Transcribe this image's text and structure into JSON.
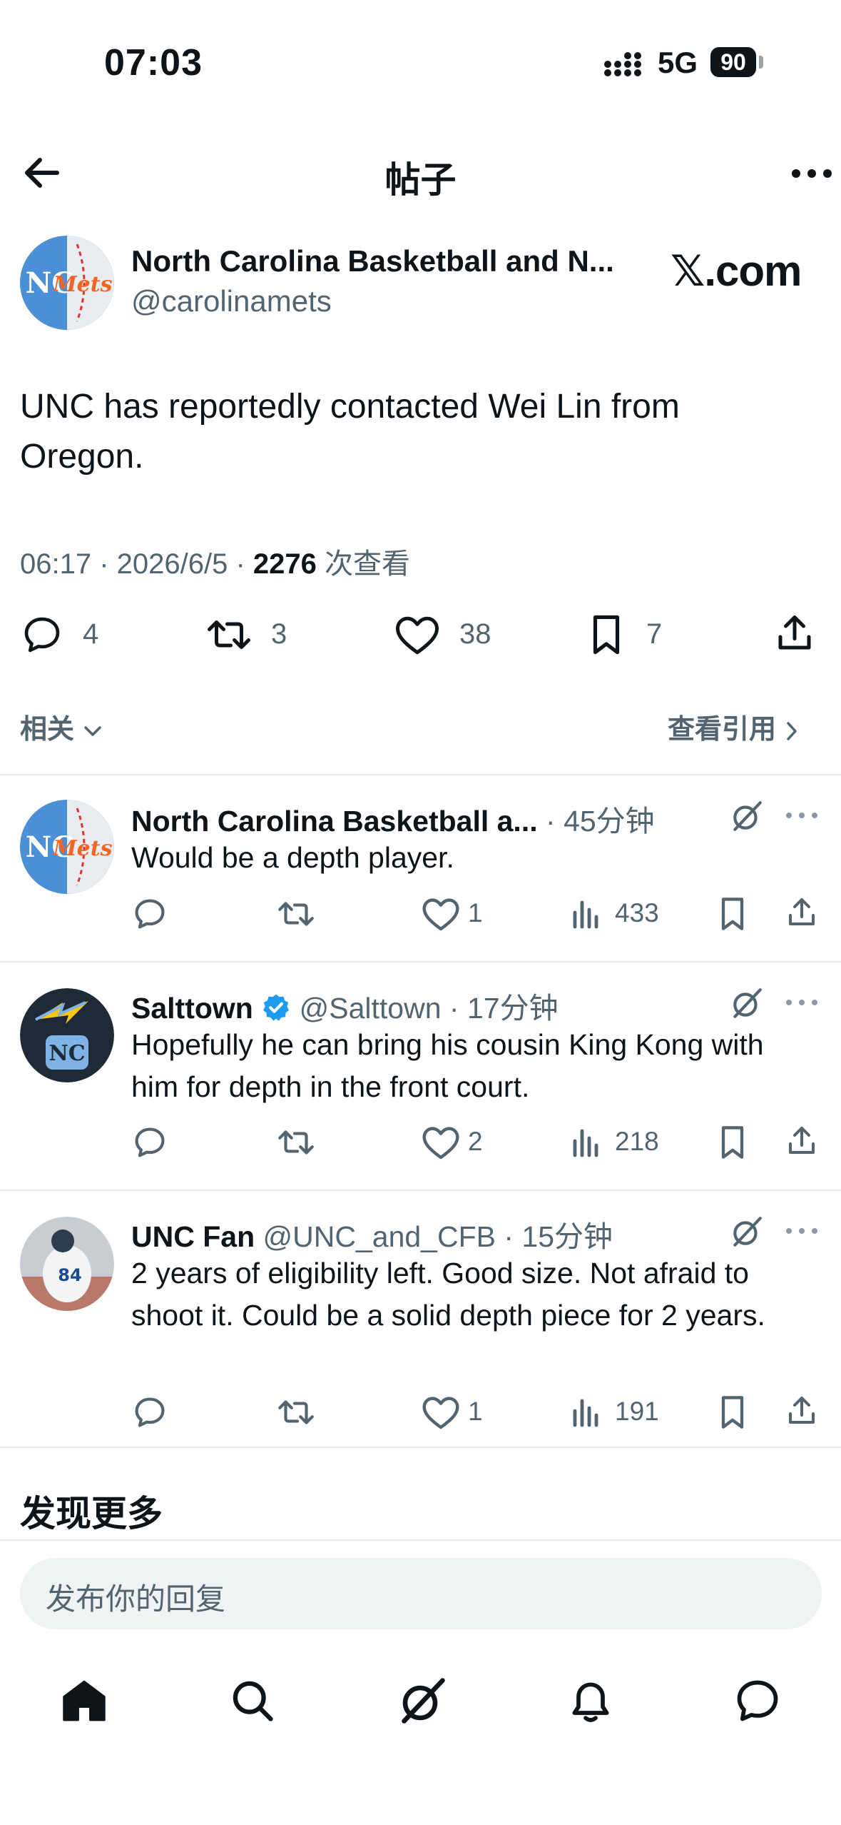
{
  "status_bar": {
    "time": "07:03",
    "network": "5G",
    "battery": "90"
  },
  "header": {
    "title": "帖子"
  },
  "post": {
    "author_name": "North Carolina Basketball and N...",
    "handle": "@carolinamets",
    "watermark": "𝕏.com",
    "text": "UNC has reportedly contacted Wei Lin from Oregon.",
    "time": "06:17",
    "date": "2026/6/5",
    "views": "2276",
    "views_label": "次查看",
    "stats": {
      "replies": "4",
      "reposts": "3",
      "likes": "38",
      "bookmarks": "7"
    },
    "related_label": "相关",
    "quotes_label": "查看引用"
  },
  "replies": [
    {
      "name": "North Carolina Basketball a...",
      "handle": "",
      "time": "45分钟",
      "text": "Would be a depth player.",
      "likes": "1",
      "views": "433"
    },
    {
      "name": "Salttown",
      "handle": "@Salttown",
      "time": "17分钟",
      "text": "Hopefully he can bring his cousin King Kong with him for depth in the front court.",
      "likes": "2",
      "views": "218"
    },
    {
      "name": "UNC Fan",
      "handle": "@UNC_and_CFB",
      "time": "15分钟",
      "text": "2 years of eligibility left. Good size. Not afraid to shoot it. Could be a solid depth piece for 2 years.",
      "likes": "1",
      "views": "191"
    }
  ],
  "discover": {
    "title": "发现更多"
  },
  "reply_input": {
    "placeholder": "发布你的回复"
  },
  "bottom_nav": [
    "home-icon",
    "search-icon",
    "grok-icon",
    "bell-icon",
    "messages-icon"
  ],
  "colors": {
    "verified": "#1d9bf0",
    "text": "#0f1419",
    "secondary": "#536471",
    "divider": "#e7e9ea"
  }
}
